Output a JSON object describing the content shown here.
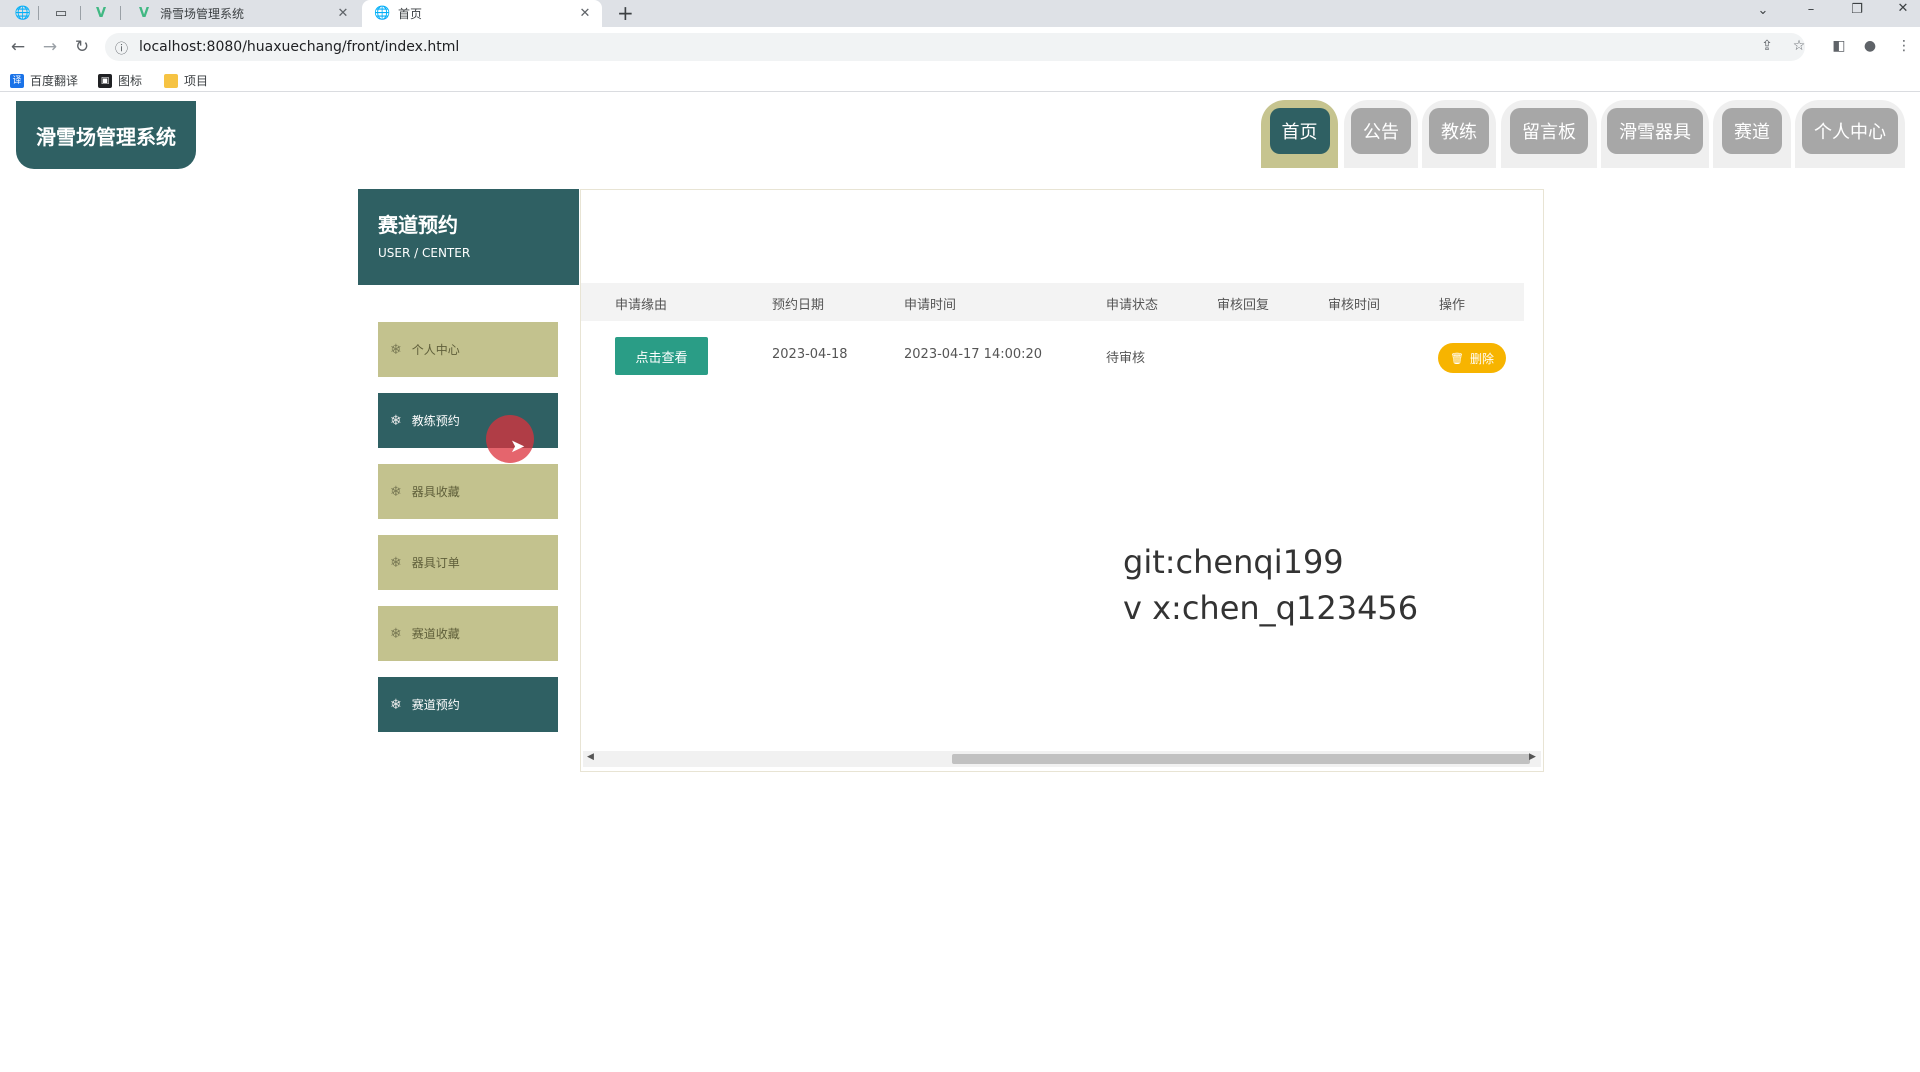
{
  "browser": {
    "tabs": [
      {
        "title": "滑雪场管理系统",
        "icon": "vue-logo-icon",
        "active": false
      },
      {
        "title": "首页",
        "icon": "globe-icon",
        "active": true
      }
    ],
    "new_tab_label": "+",
    "address": "localhost:8080/huaxuechang/front/index.html",
    "bookmarks": [
      "百度翻译",
      "图标",
      "项目"
    ]
  },
  "site": {
    "logo": "滑雪场管理系统",
    "nav": [
      "首页",
      "公告",
      "教练",
      "留言板",
      "滑雪器具",
      "赛道",
      "个人中心"
    ],
    "active_nav": "首页"
  },
  "sidebar": {
    "title": "赛道预约",
    "subtitle": "USER / CENTER",
    "items": [
      {
        "label": "个人中心",
        "active": false
      },
      {
        "label": "教练预约",
        "active": true
      },
      {
        "label": "器具收藏",
        "active": false
      },
      {
        "label": "器具订单",
        "active": false
      },
      {
        "label": "赛道收藏",
        "active": false
      },
      {
        "label": "赛道预约",
        "active": true
      }
    ]
  },
  "table": {
    "headers": [
      "申请缘由",
      "预约日期",
      "申请时间",
      "申请状态",
      "审核回复",
      "审核时间",
      "操作"
    ],
    "rows": [
      {
        "view_label": "点击查看",
        "date": "2023-04-18",
        "apply_time": "2023-04-17 14:00:20",
        "status": "待审核",
        "reply": "",
        "review_time": "",
        "delete_label": "删除"
      }
    ]
  },
  "watermark": {
    "line1": "git:chenqi199",
    "line2": "v x:chen_q123456"
  },
  "colors": {
    "primary": "#2f6063",
    "sidebar_inactive": "#c3c28e",
    "view_button": "#2a9d86",
    "delete_button": "#f7b400",
    "nav_inactive": "#a7a7a7"
  }
}
